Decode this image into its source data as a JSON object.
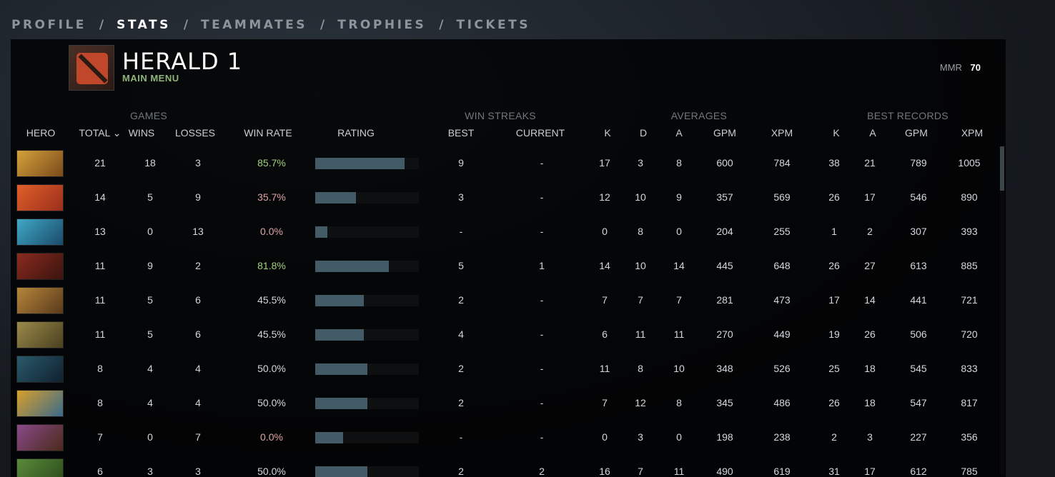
{
  "nav": {
    "tabs": [
      "PROFILE",
      "STATS",
      "TEAMMATES",
      "TROPHIES",
      "TICKETS"
    ],
    "active": "STATS",
    "separator": "/"
  },
  "header": {
    "title": "HERALD 1",
    "subtitle": "MAIN MENU",
    "mmr_label": "MMR",
    "mmr_value": "70"
  },
  "groups": {
    "games": "GAMES",
    "win_streaks": "WIN STREAKS",
    "averages": "AVERAGES",
    "best_records": "BEST RECORDS"
  },
  "columns": {
    "hero": "HERO",
    "total": "TOTAL ⌄",
    "wins": "WINS",
    "losses": "LOSSES",
    "win_rate": "WIN RATE",
    "rating": "RATING",
    "best": "BEST",
    "current": "CURRENT",
    "avg_k": "K",
    "avg_d": "D",
    "avg_a": "A",
    "avg_gpm": "GPM",
    "avg_xpm": "XPM",
    "best_k": "K",
    "best_a": "A",
    "best_gpm": "GPM",
    "best_xpm": "XPM"
  },
  "colors": {
    "win_rate_high": "#a3d17c",
    "win_rate_low": "#e0a3a3",
    "win_rate_neutral": "#d4d8dc"
  },
  "rows": [
    {
      "hero_icon": "hero-1-portrait",
      "total": "21",
      "wins": "18",
      "losses": "3",
      "win_rate": "85.7%",
      "rating": 0.86,
      "best": "9",
      "current": "-",
      "k": "17",
      "d": "3",
      "a": "8",
      "gpm": "600",
      "xpm": "784",
      "bk": "38",
      "ba": "21",
      "bgpm": "789",
      "bxpm": "1005",
      "c1": "#d4a23a",
      "c2": "#7b4a1c"
    },
    {
      "hero_icon": "hero-2-portrait",
      "total": "14",
      "wins": "5",
      "losses": "9",
      "win_rate": "35.7%",
      "rating": 0.39,
      "best": "3",
      "current": "-",
      "k": "12",
      "d": "10",
      "a": "9",
      "gpm": "357",
      "xpm": "569",
      "bk": "26",
      "ba": "17",
      "bgpm": "546",
      "bxpm": "890",
      "c1": "#e0602a",
      "c2": "#9a2f1c"
    },
    {
      "hero_icon": "hero-3-portrait",
      "total": "13",
      "wins": "0",
      "losses": "13",
      "win_rate": "0.0%",
      "rating": 0.12,
      "best": "-",
      "current": "-",
      "k": "0",
      "d": "8",
      "a": "0",
      "gpm": "204",
      "xpm": "255",
      "bk": "1",
      "ba": "2",
      "bgpm": "307",
      "bxpm": "393",
      "c1": "#3fa8c6",
      "c2": "#1c4a6a"
    },
    {
      "hero_icon": "hero-4-portrait",
      "total": "11",
      "wins": "9",
      "losses": "2",
      "win_rate": "81.8%",
      "rating": 0.71,
      "best": "5",
      "current": "1",
      "k": "14",
      "d": "10",
      "a": "14",
      "gpm": "445",
      "xpm": "648",
      "bk": "26",
      "ba": "27",
      "bgpm": "613",
      "bxpm": "885",
      "c1": "#8a2a1f",
      "c2": "#3a140f"
    },
    {
      "hero_icon": "hero-5-portrait",
      "total": "11",
      "wins": "5",
      "losses": "6",
      "win_rate": "45.5%",
      "rating": 0.47,
      "best": "2",
      "current": "-",
      "k": "7",
      "d": "7",
      "a": "7",
      "gpm": "281",
      "xpm": "473",
      "bk": "17",
      "ba": "14",
      "bgpm": "441",
      "bxpm": "721",
      "c1": "#b5853a",
      "c2": "#5a3a1c"
    },
    {
      "hero_icon": "hero-6-portrait",
      "total": "11",
      "wins": "5",
      "losses": "6",
      "win_rate": "45.5%",
      "rating": 0.47,
      "best": "4",
      "current": "-",
      "k": "6",
      "d": "11",
      "a": "11",
      "gpm": "270",
      "xpm": "449",
      "bk": "19",
      "ba": "26",
      "bgpm": "506",
      "bxpm": "720",
      "c1": "#9a8a4a",
      "c2": "#4a4020"
    },
    {
      "hero_icon": "hero-7-portrait",
      "total": "8",
      "wins": "4",
      "losses": "4",
      "win_rate": "50.0%",
      "rating": 0.5,
      "best": "2",
      "current": "-",
      "k": "11",
      "d": "8",
      "a": "10",
      "gpm": "348",
      "xpm": "526",
      "bk": "25",
      "ba": "18",
      "bgpm": "545",
      "bxpm": "833",
      "c1": "#2a5a6a",
      "c2": "#0f2030"
    },
    {
      "hero_icon": "hero-8-portrait",
      "total": "8",
      "wins": "4",
      "losses": "4",
      "win_rate": "50.0%",
      "rating": 0.5,
      "best": "2",
      "current": "-",
      "k": "7",
      "d": "12",
      "a": "8",
      "gpm": "345",
      "xpm": "486",
      "bk": "26",
      "ba": "18",
      "bgpm": "547",
      "bxpm": "817",
      "c1": "#d8a02a",
      "c2": "#3a6a8a"
    },
    {
      "hero_icon": "hero-9-portrait",
      "total": "7",
      "wins": "0",
      "losses": "7",
      "win_rate": "0.0%",
      "rating": 0.27,
      "best": "-",
      "current": "-",
      "k": "0",
      "d": "3",
      "a": "0",
      "gpm": "198",
      "xpm": "238",
      "bk": "2",
      "ba": "3",
      "bgpm": "227",
      "bxpm": "356",
      "c1": "#8a4a8a",
      "c2": "#4a2a1a"
    },
    {
      "hero_icon": "hero-10-portrait",
      "total": "6",
      "wins": "3",
      "losses": "3",
      "win_rate": "50.0%",
      "rating": 0.5,
      "best": "2",
      "current": "2",
      "k": "16",
      "d": "7",
      "a": "11",
      "gpm": "490",
      "xpm": "619",
      "bk": "31",
      "ba": "17",
      "bgpm": "612",
      "bxpm": "785",
      "c1": "#5a8a3a",
      "c2": "#2a4a1a"
    }
  ]
}
